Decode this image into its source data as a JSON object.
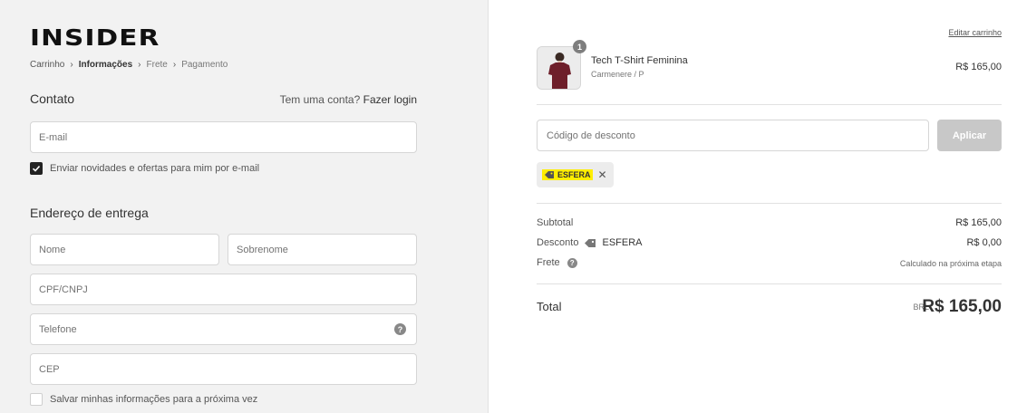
{
  "brand": {
    "logo_text": "INSIDER"
  },
  "breadcrumb": [
    {
      "label": "Carrinho"
    },
    {
      "label": "Informações"
    },
    {
      "label": "Frete"
    },
    {
      "label": "Pagamento"
    }
  ],
  "contact": {
    "title": "Contato",
    "account_prompt": "Tem uma conta?",
    "login_link": "Fazer login",
    "email_placeholder": "E-mail",
    "newsletter_label": "Enviar novidades e ofertas para mim por e-mail",
    "newsletter_checked": true
  },
  "shipping": {
    "title": "Endereço de entrega",
    "first_name_placeholder": "Nome",
    "last_name_placeholder": "Sobrenome",
    "cpf_placeholder": "CPF/CNPJ",
    "phone_placeholder": "Telefone",
    "cep_placeholder": "CEP",
    "save_info_label": "Salvar minhas informações para a próxima vez",
    "save_info_checked": false
  },
  "cart": {
    "edit_label": "Editar carrinho",
    "item": {
      "quantity": "1",
      "name": "Tech T-Shirt Feminina",
      "variant": "Carmenere / P",
      "price": "R$ 165,00"
    },
    "discount_placeholder": "Código de desconto",
    "apply_label": "Aplicar",
    "applied_code": "ESFERA",
    "summary": {
      "subtotal_label": "Subtotal",
      "subtotal_value": "R$ 165,00",
      "discount_label": "Desconto",
      "discount_code": "ESFERA",
      "discount_value": "R$ 0,00",
      "shipping_label": "Frete",
      "shipping_value": "Calculado na próxima etapa",
      "total_label": "Total",
      "currency": "BRL",
      "total_value": "R$ 165,00"
    }
  },
  "colors": {
    "left_bg": "#f2f2f2",
    "tag_highlight": "#ffee00",
    "apply_disabled": "#c8c8c8",
    "tshirt": "#6e1f2a"
  }
}
